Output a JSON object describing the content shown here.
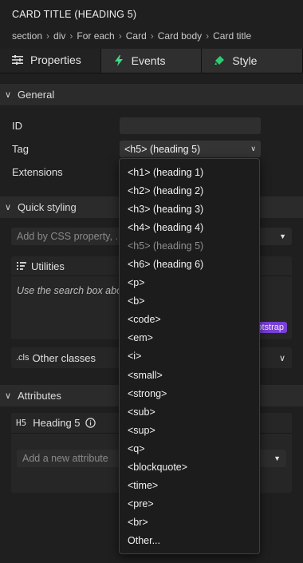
{
  "header": {
    "title": "CARD TITLE (HEADING 5)",
    "breadcrumb": [
      "section",
      "div",
      "For each",
      "Card",
      "Card body",
      "Card title"
    ]
  },
  "tabs": [
    {
      "label": "Properties",
      "icon": "sliders-icon",
      "active": true
    },
    {
      "label": "Events",
      "icon": "lightning-icon",
      "active": false
    },
    {
      "label": "Style",
      "icon": "paint-bucket-icon",
      "active": false
    }
  ],
  "general": {
    "title": "General",
    "id_label": "ID",
    "id_value": "",
    "tag_label": "Tag",
    "tag_value": "<h5> (heading 5)",
    "extensions_label": "Extensions"
  },
  "quick_styling": {
    "title": "Quick styling",
    "placeholder": "Add by CSS property, ...",
    "utilities_title": "Utilities",
    "utilities_desc": "Use the search box above to add utilities.",
    "bootstrap_badge": "Bootstrap",
    "other_classes_title": "Other classes"
  },
  "attributes": {
    "title": "Attributes",
    "element_label": "Heading 5",
    "element_tag": "H5",
    "new_attribute_placeholder": "Add a new attribute"
  },
  "dropdown": {
    "items": [
      {
        "label": "<h1> (heading 1)",
        "disabled": false
      },
      {
        "label": "<h2> (heading 2)",
        "disabled": false
      },
      {
        "label": "<h3> (heading 3)",
        "disabled": false
      },
      {
        "label": "<h4> (heading 4)",
        "disabled": false
      },
      {
        "label": "<h5> (heading 5)",
        "disabled": true
      },
      {
        "label": "<h6> (heading 6)",
        "disabled": false
      },
      {
        "label": "<p>",
        "disabled": false
      },
      {
        "label": "<b>",
        "disabled": false
      },
      {
        "label": "<code>",
        "disabled": false
      },
      {
        "label": "<em>",
        "disabled": false
      },
      {
        "label": "<i>",
        "disabled": false
      },
      {
        "label": "<small>",
        "disabled": false
      },
      {
        "label": "<strong>",
        "disabled": false
      },
      {
        "label": "<sub>",
        "disabled": false
      },
      {
        "label": "<sup>",
        "disabled": false
      },
      {
        "label": "<q>",
        "disabled": false
      },
      {
        "label": "<blockquote>",
        "disabled": false
      },
      {
        "label": "<time>",
        "disabled": false
      },
      {
        "label": "<pre>",
        "disabled": false
      },
      {
        "label": "<br>",
        "disabled": false
      },
      {
        "label": "Other...",
        "disabled": false
      }
    ]
  },
  "colors": {
    "events_icon": "#3ddc84",
    "style_icon": "#2ecc71",
    "bootstrap_badge": "#7a3fd6"
  }
}
